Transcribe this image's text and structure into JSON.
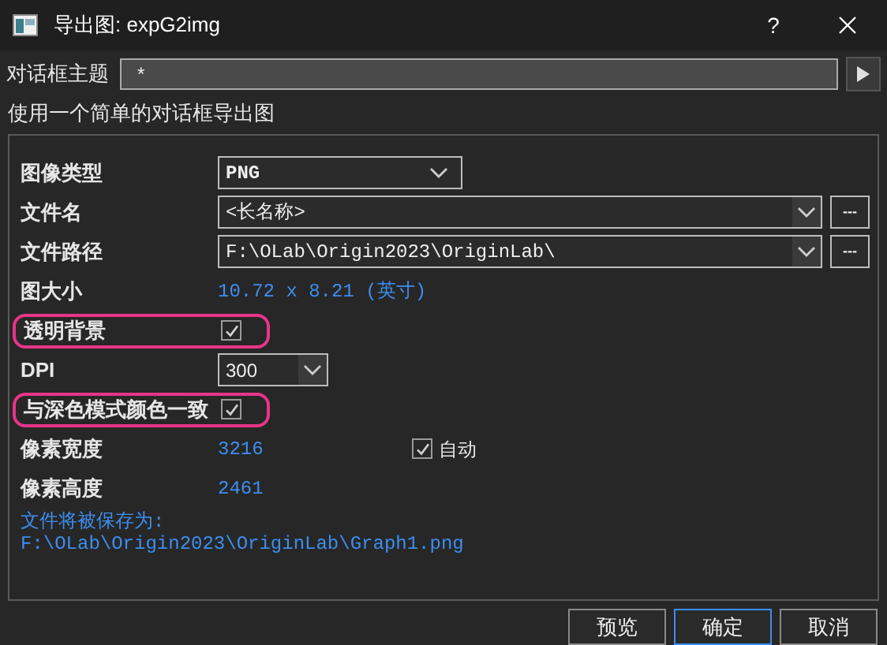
{
  "window": {
    "title": "导出图: expG2img",
    "help": "?"
  },
  "theme": {
    "label": "对话框主题",
    "value": "*"
  },
  "description": "使用一个简单的对话框导出图",
  "fields": [
    {
      "kind": "dropdown",
      "label": "图像类型",
      "value": "PNG"
    },
    {
      "kind": "combo_browse",
      "label": "文件名",
      "value": "<长名称>",
      "browse": "---"
    },
    {
      "kind": "combo_browse",
      "label": "文件路径",
      "value": "F:\\OLab\\Origin2023\\OriginLab\\",
      "browse": "---"
    },
    {
      "kind": "info",
      "label": "图大小",
      "value": "10.72 x 8.21 (英寸)"
    },
    {
      "kind": "checkbox",
      "label": "透明背景",
      "checked": true,
      "highlighted": true
    },
    {
      "kind": "short_dropdown",
      "label": "DPI",
      "value": "300"
    },
    {
      "kind": "checkbox",
      "label": "与深色模式颜色一致",
      "checked": true,
      "highlighted": true
    },
    {
      "kind": "number",
      "label": "像素宽度",
      "value": "3216",
      "option": {
        "label": "自动",
        "checked": true
      }
    },
    {
      "kind": "number",
      "label": "像素高度",
      "value": "2461"
    }
  ],
  "save_note": [
    "文件将被保存为:",
    "F:\\OLab\\Origin2023\\OriginLab\\Graph1.png"
  ],
  "buttons": [
    {
      "label": "预览",
      "default": false
    },
    {
      "label": "确定",
      "default": true
    },
    {
      "label": "取消",
      "default": false
    }
  ]
}
